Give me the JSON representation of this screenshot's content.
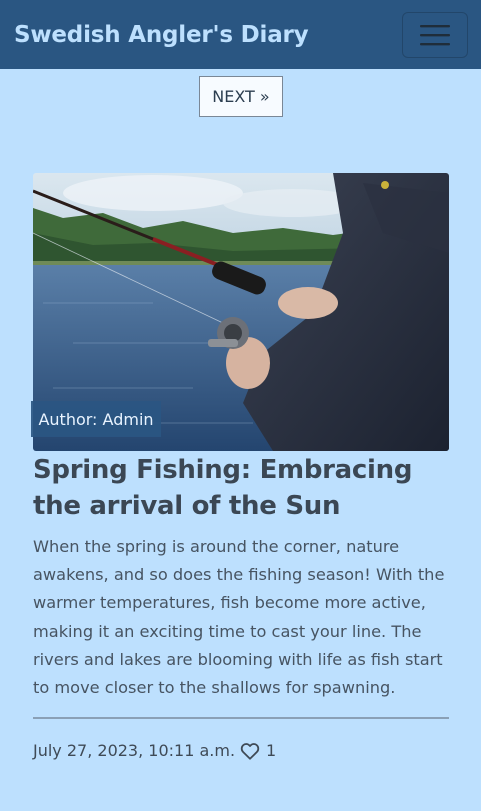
{
  "navbar": {
    "brand": "Swedish Angler's Diary",
    "toggler_icon": "hamburger-menu-icon"
  },
  "pagination": {
    "next_label": "NEXT »"
  },
  "post": {
    "image_subject": "angler holding fishing rod and reel by a lake",
    "author_label": "Author: Admin",
    "title": "Spring Fishing: Embracing the arrival of the Sun",
    "excerpt": "When the spring is around the corner, nature awakens, and so does the fishing season! With the warmer temperatures, fish become more active, making it an exciting time to cast your line. The rivers and lakes are blooming with life as fish start to move closer to the shallows for spawning.",
    "date": "July 27, 2023, 10:11 a.m.",
    "like_icon": "heart-outline-icon",
    "likes": "1"
  },
  "colors": {
    "page_background": "#bde0fe",
    "navbar_background": "#2a5682",
    "brand_text": "#bde0fe",
    "author_badge": "#2a5682"
  }
}
